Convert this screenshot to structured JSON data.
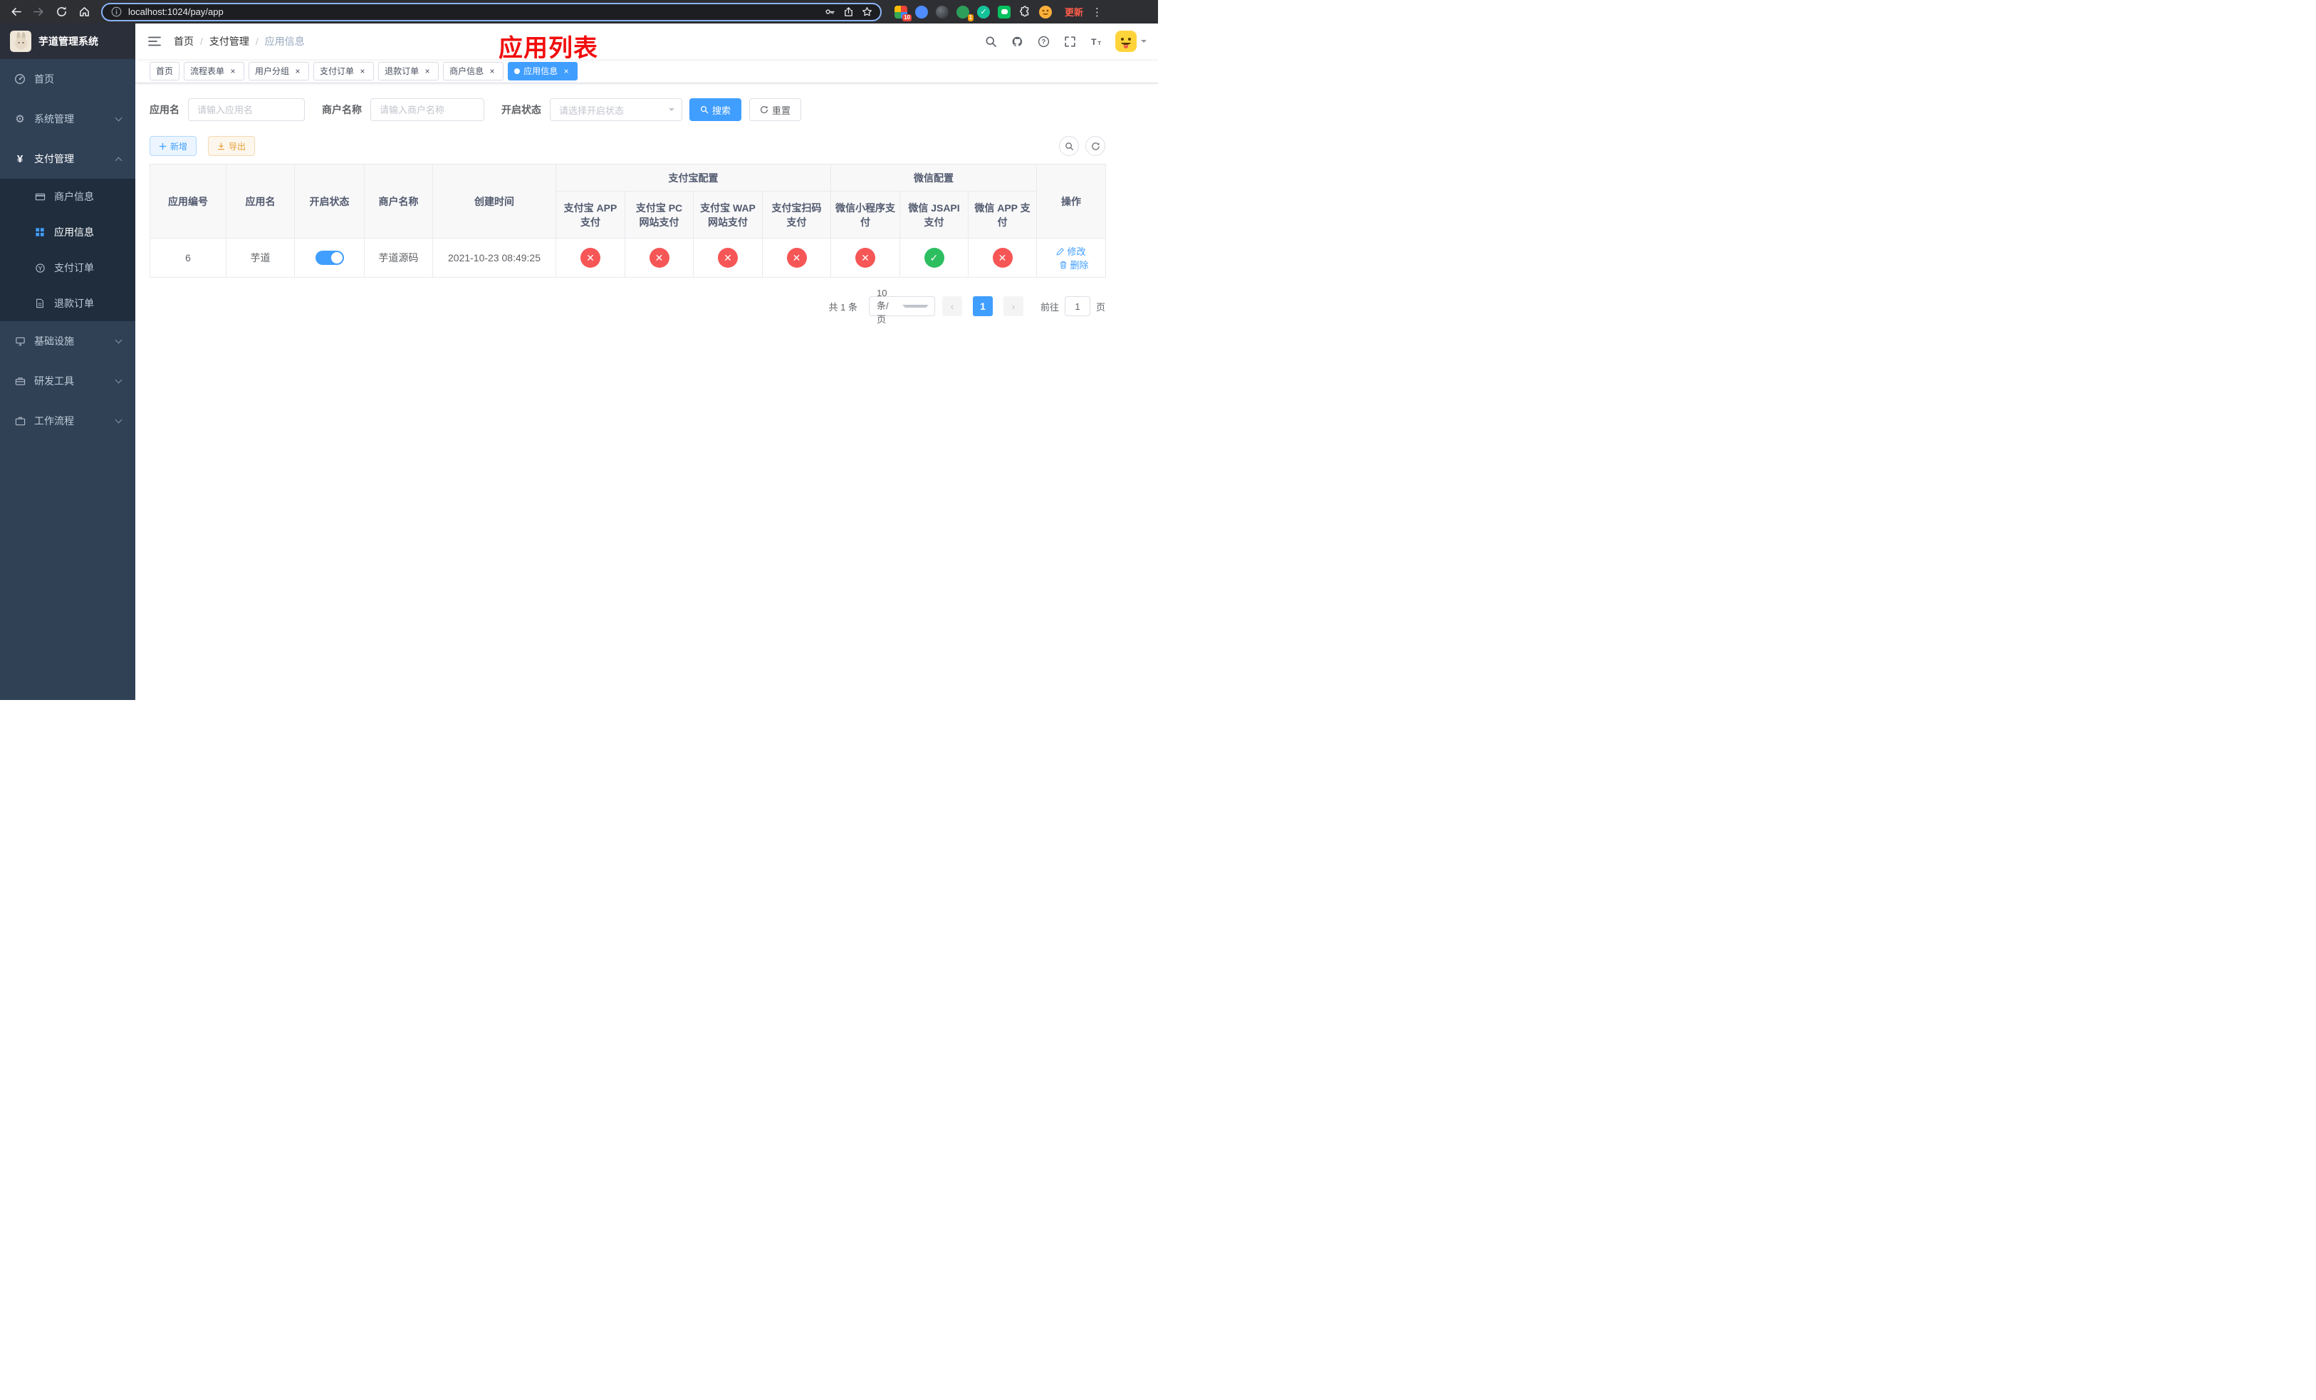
{
  "browser": {
    "url": "localhost:1024/pay/app",
    "update_label": "更新",
    "extensions_badge": "10",
    "avatar_badge": "1"
  },
  "sidebar": {
    "title": "芋道管理系统",
    "items": [
      {
        "label": "首页"
      },
      {
        "label": "系统管理"
      },
      {
        "label": "支付管理"
      },
      {
        "label": "基础设施"
      },
      {
        "label": "研发工具"
      },
      {
        "label": "工作流程"
      }
    ],
    "payment_children": [
      {
        "label": "商户信息"
      },
      {
        "label": "应用信息"
      },
      {
        "label": "支付订单"
      },
      {
        "label": "退款订单"
      }
    ]
  },
  "navbar": {
    "breadcrumb": [
      "首页",
      "支付管理",
      "应用信息"
    ],
    "annotation": "应用列表"
  },
  "tags": [
    {
      "label": "首页"
    },
    {
      "label": "流程表单"
    },
    {
      "label": "用户分组"
    },
    {
      "label": "支付订单"
    },
    {
      "label": "退款订单"
    },
    {
      "label": "商户信息"
    },
    {
      "label": "应用信息"
    }
  ],
  "filters": {
    "app_name_label": "应用名",
    "app_name_placeholder": "请输入应用名",
    "merchant_label": "商户名称",
    "merchant_placeholder": "请输入商户名称",
    "status_label": "开启状态",
    "status_placeholder": "请选择开启状态",
    "search_label": "搜索",
    "reset_label": "重置"
  },
  "toolbar": {
    "add_label": "新增",
    "export_label": "导出"
  },
  "table": {
    "groups": {
      "alipay": "支付宝配置",
      "wechat": "微信配置"
    },
    "columns": [
      "应用编号",
      "应用名",
      "开启状态",
      "商户名称",
      "创建时间",
      "支付宝 APP 支付",
      "支付宝 PC 网站支付",
      "支付宝 WAP 网站支付",
      "支付宝扫码支付",
      "微信小程序支付",
      "微信 JSAPI 支付",
      "微信 APP 支付",
      "操作"
    ],
    "rows": [
      {
        "id": "6",
        "name": "芋道",
        "enabled": true,
        "merchant": "芋道源码",
        "created": "2021-10-23 08:49:25",
        "pay_channels": [
          false,
          false,
          false,
          false,
          false,
          true,
          false
        ],
        "edit_label": "修改",
        "delete_label": "删除"
      }
    ]
  },
  "pagination": {
    "total": "共 1 条",
    "page_size": "10条/页",
    "page": "1",
    "goto": "前往",
    "goto_value": "1",
    "unit": "页"
  }
}
